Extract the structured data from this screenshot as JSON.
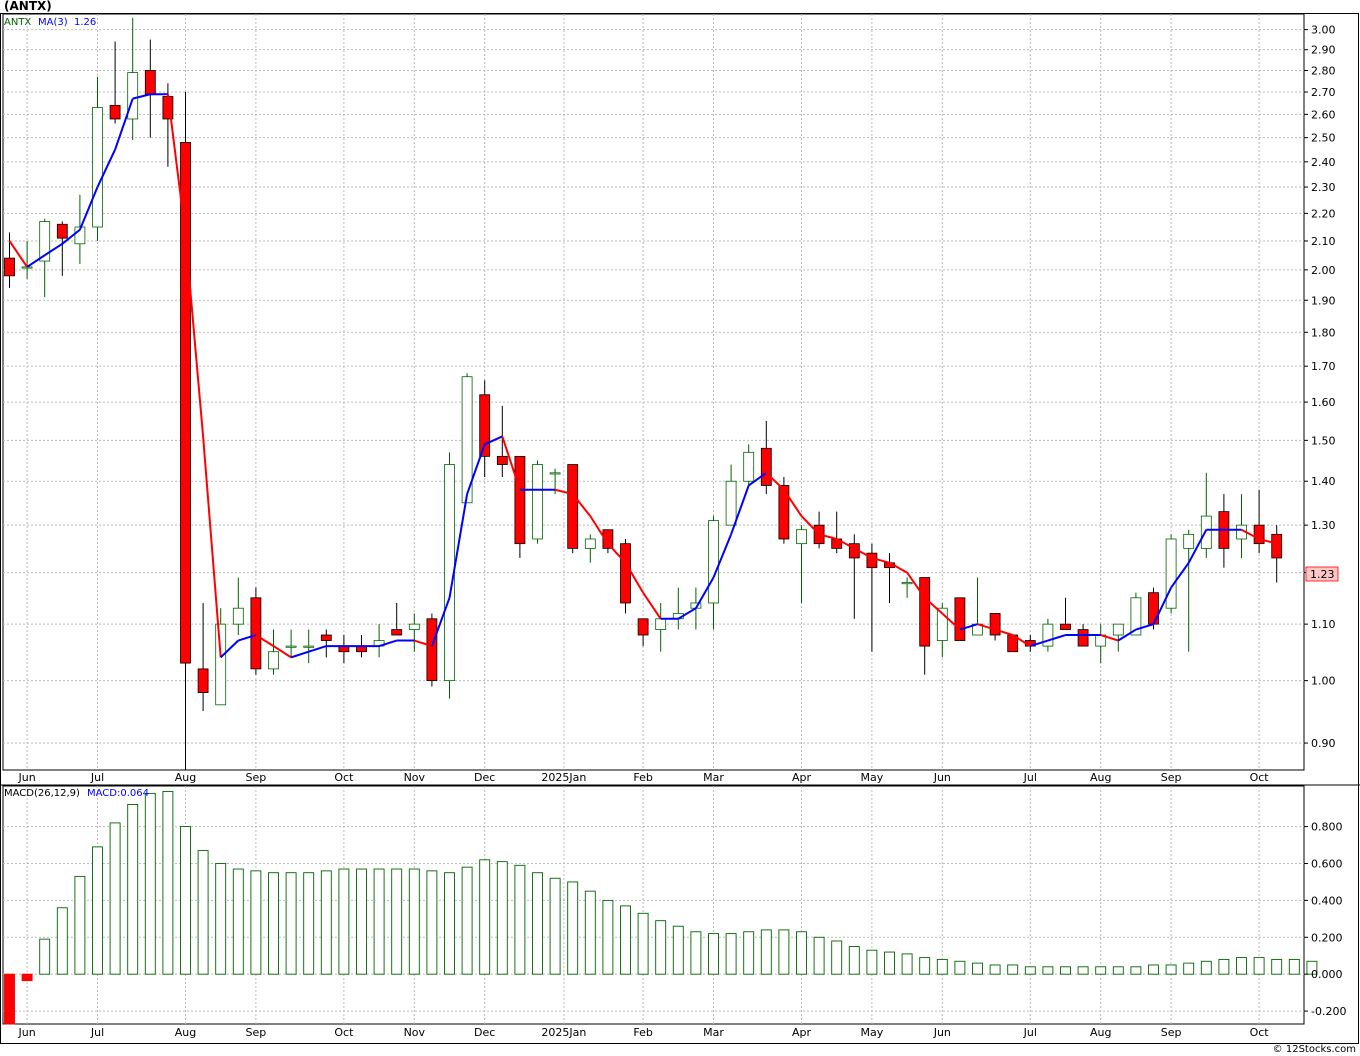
{
  "header": {
    "symbol_label": "(ANTX)",
    "legend_symbol": "ANTX",
    "legend_ma": "MA(3)",
    "legend_ma_value": "1.26"
  },
  "macd_header": {
    "label": "MACD(26,12,9)",
    "value_label": "MACD:0.064"
  },
  "last_price_tag": "1.23",
  "watermark": "© 12Stocks.com",
  "colors": {
    "up_candle_stroke": "#006400",
    "down_candle_fill": "#ff0000",
    "ma_up": "#0000ff",
    "ma_down": "#ff0000",
    "macd_pos": "#006400",
    "macd_neg": "#ff0000",
    "grid": "#bbbbbb",
    "price_tag_fill": "#ffc8c8"
  },
  "chart_data": [
    {
      "type": "candlestick",
      "title": "(ANTX)",
      "interval": "weekly",
      "y_scale": "log",
      "ylim": [
        0.86,
        3.08
      ],
      "y_ticks": [
        "3.00",
        "2.90",
        "2.80",
        "2.70",
        "2.60",
        "2.50",
        "2.40",
        "2.30",
        "2.20",
        "2.10",
        "2.00",
        "1.90",
        "1.80",
        "1.70",
        "1.60",
        "1.50",
        "1.40",
        "1.30",
        "1.20",
        "1.10",
        "1.00",
        "0.90"
      ],
      "x_labels": [
        {
          "label": "Jun",
          "week": 1
        },
        {
          "label": "Jul",
          "week": 5
        },
        {
          "label": "Aug",
          "week": 10
        },
        {
          "label": "Sep",
          "week": 14
        },
        {
          "label": "Oct",
          "week": 19
        },
        {
          "label": "Nov",
          "week": 23
        },
        {
          "label": "Dec",
          "week": 27
        },
        {
          "label": "2025Jan",
          "week": 31.5
        },
        {
          "label": "Feb",
          "week": 36
        },
        {
          "label": "Mar",
          "week": 40
        },
        {
          "label": "Apr",
          "week": 45
        },
        {
          "label": "May",
          "week": 49
        },
        {
          "label": "Jun",
          "week": 53
        },
        {
          "label": "Jul",
          "week": 58
        },
        {
          "label": "Aug",
          "week": 62
        },
        {
          "label": "Sep",
          "week": 66
        },
        {
          "label": "Oct",
          "week": 71
        }
      ],
      "candles": [
        {
          "o": 2.04,
          "h": 2.13,
          "l": 1.94,
          "c": 1.98
        },
        {
          "o": 2.01,
          "h": 2.1,
          "l": 1.97,
          "c": 2.01
        },
        {
          "o": 2.03,
          "h": 2.18,
          "l": 1.91,
          "c": 2.17
        },
        {
          "o": 2.16,
          "h": 2.17,
          "l": 1.98,
          "c": 2.11
        },
        {
          "o": 2.09,
          "h": 2.27,
          "l": 2.02,
          "c": 2.15
        },
        {
          "o": 2.15,
          "h": 2.77,
          "l": 2.1,
          "c": 2.63
        },
        {
          "o": 2.64,
          "h": 2.94,
          "l": 2.56,
          "c": 2.58
        },
        {
          "o": 2.58,
          "h": 3.06,
          "l": 2.49,
          "c": 2.79
        },
        {
          "o": 2.8,
          "h": 2.95,
          "l": 2.5,
          "c": 2.69
        },
        {
          "o": 2.68,
          "h": 2.74,
          "l": 2.38,
          "c": 2.58
        },
        {
          "o": 2.48,
          "h": 2.7,
          "l": 0.86,
          "c": 1.03
        },
        {
          "o": 1.02,
          "h": 1.14,
          "l": 0.95,
          "c": 0.98
        },
        {
          "o": 0.96,
          "h": 1.13,
          "l": 0.96,
          "c": 1.1
        },
        {
          "o": 1.1,
          "h": 1.19,
          "l": 1.08,
          "c": 1.13
        },
        {
          "o": 1.15,
          "h": 1.17,
          "l": 1.01,
          "c": 1.02
        },
        {
          "o": 1.02,
          "h": 1.09,
          "l": 1.01,
          "c": 1.05
        },
        {
          "o": 1.06,
          "h": 1.09,
          "l": 1.04,
          "c": 1.06
        },
        {
          "o": 1.06,
          "h": 1.09,
          "l": 1.03,
          "c": 1.06
        },
        {
          "o": 1.08,
          "h": 1.09,
          "l": 1.04,
          "c": 1.07
        },
        {
          "o": 1.06,
          "h": 1.08,
          "l": 1.03,
          "c": 1.05
        },
        {
          "o": 1.06,
          "h": 1.08,
          "l": 1.04,
          "c": 1.05
        },
        {
          "o": 1.06,
          "h": 1.1,
          "l": 1.04,
          "c": 1.07
        },
        {
          "o": 1.09,
          "h": 1.14,
          "l": 1.08,
          "c": 1.08
        },
        {
          "o": 1.09,
          "h": 1.12,
          "l": 1.05,
          "c": 1.1
        },
        {
          "o": 1.11,
          "h": 1.12,
          "l": 0.99,
          "c": 1.0
        },
        {
          "o": 1.0,
          "h": 1.47,
          "l": 0.97,
          "c": 1.44
        },
        {
          "o": 1.35,
          "h": 1.68,
          "l": 1.35,
          "c": 1.67
        },
        {
          "o": 1.62,
          "h": 1.66,
          "l": 1.41,
          "c": 1.46
        },
        {
          "o": 1.46,
          "h": 1.59,
          "l": 1.41,
          "c": 1.44
        },
        {
          "o": 1.46,
          "h": 1.46,
          "l": 1.23,
          "c": 1.26
        },
        {
          "o": 1.27,
          "h": 1.45,
          "l": 1.26,
          "c": 1.44
        },
        {
          "o": 1.42,
          "h": 1.43,
          "l": 1.37,
          "c": 1.42
        },
        {
          "o": 1.44,
          "h": 1.44,
          "l": 1.24,
          "c": 1.25
        },
        {
          "o": 1.25,
          "h": 1.28,
          "l": 1.22,
          "c": 1.27
        },
        {
          "o": 1.29,
          "h": 1.29,
          "l": 1.24,
          "c": 1.25
        },
        {
          "o": 1.26,
          "h": 1.27,
          "l": 1.12,
          "c": 1.14
        },
        {
          "o": 1.11,
          "h": 1.11,
          "l": 1.06,
          "c": 1.08
        },
        {
          "o": 1.09,
          "h": 1.14,
          "l": 1.05,
          "c": 1.11
        },
        {
          "o": 1.11,
          "h": 1.17,
          "l": 1.09,
          "c": 1.12
        },
        {
          "o": 1.13,
          "h": 1.17,
          "l": 1.09,
          "c": 1.14
        },
        {
          "o": 1.14,
          "h": 1.32,
          "l": 1.09,
          "c": 1.31
        },
        {
          "o": 1.3,
          "h": 1.44,
          "l": 1.3,
          "c": 1.4
        },
        {
          "o": 1.4,
          "h": 1.49,
          "l": 1.39,
          "c": 1.47
        },
        {
          "o": 1.48,
          "h": 1.55,
          "l": 1.37,
          "c": 1.39
        },
        {
          "o": 1.39,
          "h": 1.41,
          "l": 1.26,
          "c": 1.27
        },
        {
          "o": 1.26,
          "h": 1.3,
          "l": 1.14,
          "c": 1.29
        },
        {
          "o": 1.3,
          "h": 1.33,
          "l": 1.25,
          "c": 1.26
        },
        {
          "o": 1.27,
          "h": 1.33,
          "l": 1.24,
          "c": 1.25
        },
        {
          "o": 1.26,
          "h": 1.28,
          "l": 1.11,
          "c": 1.23
        },
        {
          "o": 1.24,
          "h": 1.26,
          "l": 1.05,
          "c": 1.21
        },
        {
          "o": 1.22,
          "h": 1.24,
          "l": 1.14,
          "c": 1.21
        },
        {
          "o": 1.18,
          "h": 1.19,
          "l": 1.15,
          "c": 1.18
        },
        {
          "o": 1.19,
          "h": 1.19,
          "l": 1.01,
          "c": 1.06
        },
        {
          "o": 1.07,
          "h": 1.14,
          "l": 1.04,
          "c": 1.13
        },
        {
          "o": 1.15,
          "h": 1.15,
          "l": 1.07,
          "c": 1.07
        },
        {
          "o": 1.08,
          "h": 1.19,
          "l": 1.08,
          "c": 1.1
        },
        {
          "o": 1.12,
          "h": 1.12,
          "l": 1.07,
          "c": 1.08
        },
        {
          "o": 1.08,
          "h": 1.08,
          "l": 1.05,
          "c": 1.05
        },
        {
          "o": 1.07,
          "h": 1.08,
          "l": 1.05,
          "c": 1.06
        },
        {
          "o": 1.06,
          "h": 1.11,
          "l": 1.05,
          "c": 1.1
        },
        {
          "o": 1.1,
          "h": 1.15,
          "l": 1.09,
          "c": 1.09
        },
        {
          "o": 1.09,
          "h": 1.1,
          "l": 1.06,
          "c": 1.06
        },
        {
          "o": 1.06,
          "h": 1.1,
          "l": 1.03,
          "c": 1.08
        },
        {
          "o": 1.08,
          "h": 1.1,
          "l": 1.05,
          "c": 1.1
        },
        {
          "o": 1.08,
          "h": 1.16,
          "l": 1.08,
          "c": 1.15
        },
        {
          "o": 1.16,
          "h": 1.17,
          "l": 1.09,
          "c": 1.1
        },
        {
          "o": 1.13,
          "h": 1.28,
          "l": 1.12,
          "c": 1.27
        },
        {
          "o": 1.25,
          "h": 1.29,
          "l": 1.05,
          "c": 1.28
        },
        {
          "o": 1.25,
          "h": 1.42,
          "l": 1.23,
          "c": 1.32
        },
        {
          "o": 1.33,
          "h": 1.37,
          "l": 1.21,
          "c": 1.25
        },
        {
          "o": 1.27,
          "h": 1.37,
          "l": 1.23,
          "c": 1.3
        },
        {
          "o": 1.3,
          "h": 1.38,
          "l": 1.24,
          "c": 1.26
        },
        {
          "o": 1.28,
          "h": 1.3,
          "l": 1.18,
          "c": 1.23
        }
      ],
      "ma3": [
        2.1,
        2.01,
        2.05,
        2.09,
        2.14,
        2.3,
        2.45,
        2.67,
        2.69,
        2.69,
        2.12,
        1.51,
        1.04,
        1.07,
        1.08,
        1.06,
        1.04,
        1.05,
        1.06,
        1.06,
        1.06,
        1.06,
        1.07,
        1.07,
        1.06,
        1.15,
        1.37,
        1.49,
        1.51,
        1.38,
        1.38,
        1.38,
        1.37,
        1.32,
        1.26,
        1.22,
        1.16,
        1.11,
        1.11,
        1.13,
        1.19,
        1.28,
        1.39,
        1.42,
        1.38,
        1.32,
        1.28,
        1.27,
        1.25,
        1.23,
        1.22,
        1.2,
        1.15,
        1.12,
        1.09,
        1.1,
        1.09,
        1.08,
        1.06,
        1.07,
        1.08,
        1.08,
        1.08,
        1.07,
        1.09,
        1.1,
        1.17,
        1.22,
        1.29,
        1.29,
        1.29,
        1.27,
        1.26
      ]
    },
    {
      "type": "bar",
      "title": "MACD(26,12,9)",
      "ylim": [
        -0.27,
        1.02
      ],
      "y_ticks": [
        "0.800",
        "0.600",
        "0.400",
        "0.200",
        "0.000",
        "-0.200"
      ],
      "values": [
        -0.3,
        -0.035,
        0.19,
        0.36,
        0.53,
        0.69,
        0.82,
        0.92,
        0.98,
        0.99,
        0.8,
        0.67,
        0.6,
        0.57,
        0.56,
        0.55,
        0.55,
        0.55,
        0.56,
        0.57,
        0.57,
        0.57,
        0.57,
        0.57,
        0.56,
        0.55,
        0.58,
        0.62,
        0.61,
        0.59,
        0.55,
        0.52,
        0.5,
        0.45,
        0.4,
        0.37,
        0.33,
        0.29,
        0.26,
        0.23,
        0.22,
        0.22,
        0.23,
        0.24,
        0.24,
        0.23,
        0.2,
        0.18,
        0.15,
        0.13,
        0.12,
        0.11,
        0.09,
        0.08,
        0.07,
        0.06,
        0.05,
        0.05,
        0.04,
        0.04,
        0.04,
        0.04,
        0.04,
        0.04,
        0.04,
        0.05,
        0.05,
        0.06,
        0.07,
        0.08,
        0.09,
        0.09,
        0.08,
        0.08,
        0.07
      ]
    }
  ]
}
